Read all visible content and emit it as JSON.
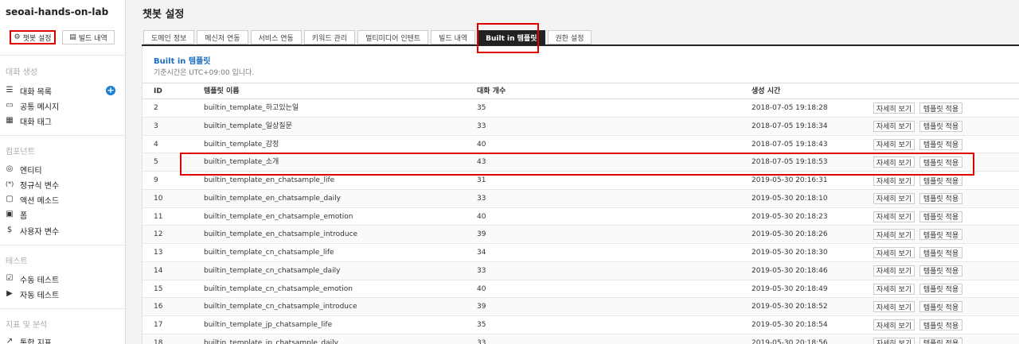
{
  "sidebar": {
    "project_title": "seoai-hands-on-lab",
    "buttons": [
      {
        "label": "챗봇 설정",
        "icon": "gear-icon",
        "glyph": "⚙"
      },
      {
        "label": "빌드 내역",
        "icon": "build-history-icon",
        "glyph": "▤"
      }
    ],
    "sections": [
      {
        "title": "대화 생성",
        "items": [
          {
            "label": "대화 목록",
            "icon": "list-icon",
            "glyph": "☰"
          },
          {
            "label": "공통 메시지",
            "icon": "message-icon",
            "glyph": "▭"
          },
          {
            "label": "대화 태그",
            "icon": "tag-icon",
            "glyph": "▦"
          }
        ]
      },
      {
        "title": "컴포넌트",
        "items": [
          {
            "label": "엔티티",
            "icon": "entity-icon",
            "glyph": "◎"
          },
          {
            "label": "정규식 변수",
            "icon": "regex-icon",
            "glyph": "(*)"
          },
          {
            "label": "액션 메소드",
            "icon": "action-icon",
            "glyph": "▢"
          },
          {
            "label": "폼",
            "icon": "form-icon",
            "glyph": "▣"
          },
          {
            "label": "사용자 변수",
            "icon": "variable-icon",
            "glyph": "$"
          }
        ]
      },
      {
        "title": "테스트",
        "items": [
          {
            "label": "수동 테스트",
            "icon": "manual-test-icon",
            "glyph": "☑"
          },
          {
            "label": "자동 테스트",
            "icon": "auto-test-icon",
            "glyph": "▶"
          }
        ]
      },
      {
        "title": "지표 및 분석",
        "items": [
          {
            "label": "통합 지표",
            "icon": "chart-icon",
            "glyph": "↗"
          }
        ]
      }
    ]
  },
  "main": {
    "title": "챗봇 설정",
    "tabs": [
      {
        "label": "도메인 정보",
        "active": false
      },
      {
        "label": "메신저 연동",
        "active": false
      },
      {
        "label": "서비스 연동",
        "active": false
      },
      {
        "label": "키워드 관리",
        "active": false
      },
      {
        "label": "멀티미디어 인텐트",
        "active": false
      },
      {
        "label": "빌드 내역",
        "active": false
      },
      {
        "label": "Built in 템플릿",
        "active": true
      },
      {
        "label": "권한 설정",
        "active": false
      }
    ],
    "panel": {
      "title": "Built in 템플릿",
      "subtitle": "기준시간은 UTC+09:00 입니다.",
      "columns": {
        "id": "ID",
        "name": "템플릿 이름",
        "count": "대화 개수",
        "time": "생성 시간"
      },
      "detail_label": "자세히 보기",
      "apply_label": "템플릿 적용",
      "rows": [
        {
          "id": "2",
          "name": "builtin_template_하고있는일",
          "count": "35",
          "time": "2018-07-05 19:18:28"
        },
        {
          "id": "3",
          "name": "builtin_template_일상질문",
          "count": "33",
          "time": "2018-07-05 19:18:34"
        },
        {
          "id": "4",
          "name": "builtin_template_감정",
          "count": "40",
          "time": "2018-07-05 19:18:43"
        },
        {
          "id": "5",
          "name": "builtin_template_소개",
          "count": "43",
          "time": "2018-07-05 19:18:53"
        },
        {
          "id": "9",
          "name": "builtin_template_en_chatsample_life",
          "count": "31",
          "time": "2019-05-30 20:16:31"
        },
        {
          "id": "10",
          "name": "builtin_template_en_chatsample_daily",
          "count": "33",
          "time": "2019-05-30 20:18:10"
        },
        {
          "id": "11",
          "name": "builtin_template_en_chatsample_emotion",
          "count": "40",
          "time": "2019-05-30 20:18:23"
        },
        {
          "id": "12",
          "name": "builtin_template_en_chatsample_introduce",
          "count": "39",
          "time": "2019-05-30 20:18:26"
        },
        {
          "id": "13",
          "name": "builtin_template_cn_chatsample_life",
          "count": "34",
          "time": "2019-05-30 20:18:30"
        },
        {
          "id": "14",
          "name": "builtin_template_cn_chatsample_daily",
          "count": "33",
          "time": "2019-05-30 20:18:46"
        },
        {
          "id": "15",
          "name": "builtin_template_cn_chatsample_emotion",
          "count": "40",
          "time": "2019-05-30 20:18:49"
        },
        {
          "id": "16",
          "name": "builtin_template_cn_chatsample_introduce",
          "count": "39",
          "time": "2019-05-30 20:18:52"
        },
        {
          "id": "17",
          "name": "builtin_template_jp_chatsample_life",
          "count": "35",
          "time": "2019-05-30 20:18:54"
        },
        {
          "id": "18",
          "name": "builtin_template_jp_chatsample_daily",
          "count": "33",
          "time": "2019-05-30 20:18:56"
        }
      ]
    }
  },
  "colors": {
    "highlight": "#e00000",
    "accent": "#1c6fbf",
    "active_tab": "#222222"
  }
}
